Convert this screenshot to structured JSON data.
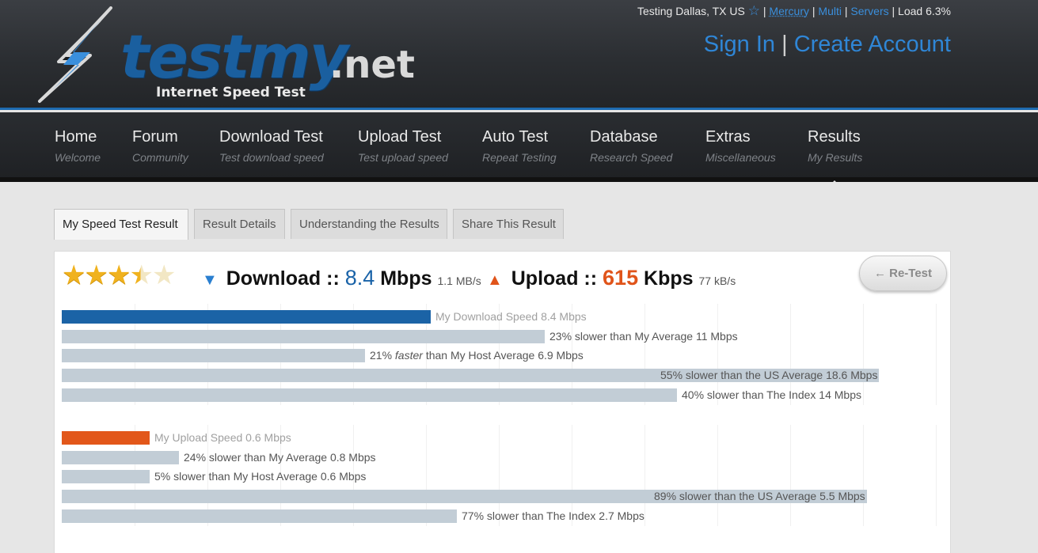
{
  "header": {
    "logo_text": "testmy",
    "logo_tld": ".net",
    "logo_tagline": "Internet Speed Test",
    "testing_location": "Testing Dallas, TX US",
    "server_links": [
      "Mercury",
      "Multi",
      "Servers"
    ],
    "load_text": "Load 6.3%",
    "sign_in": "Sign In",
    "create_account": "Create Account",
    "divider": "|"
  },
  "nav": [
    {
      "title": "Home",
      "sub": "Welcome"
    },
    {
      "title": "Forum",
      "sub": "Community"
    },
    {
      "title": "Download Test",
      "sub": "Test download speed"
    },
    {
      "title": "Upload Test",
      "sub": "Test upload speed"
    },
    {
      "title": "Auto Test",
      "sub": "Repeat Testing"
    },
    {
      "title": "Database",
      "sub": "Research Speed"
    },
    {
      "title": "Extras",
      "sub": "Miscellaneous"
    },
    {
      "title": "Results",
      "sub": "My Results"
    }
  ],
  "tabs": [
    "My Speed Test Result",
    "Result Details",
    "Understanding the Results",
    "Share This Result"
  ],
  "result": {
    "rating": 3.5,
    "download_label": "Download ::",
    "download_value": "8.4",
    "download_unit": "Mbps",
    "download_small": "1.1 MB/s",
    "upload_label": "Upload ::",
    "upload_value": "615",
    "upload_unit": "Kbps",
    "upload_small": "77 kB/s",
    "retest_label": "← Re-Test"
  },
  "chart_data": [
    {
      "type": "bar",
      "orientation": "horizontal",
      "unit": "Mbps",
      "xlim": [
        0,
        18.6
      ],
      "bars": [
        {
          "value": 8.4,
          "label": "My Download Speed 8.4 Mbps",
          "primary": true
        },
        {
          "value": 11,
          "label": "23% slower than My Average 11 Mbps"
        },
        {
          "value": 6.9,
          "label_parts": [
            "21% ",
            "faster",
            " than My Host Average 6.9 Mbps"
          ]
        },
        {
          "value": 18.6,
          "label": "55% slower than the US Average 18.6 Mbps"
        },
        {
          "value": 14,
          "label": "40% slower than The Index 14 Mbps"
        }
      ]
    },
    {
      "type": "bar",
      "orientation": "horizontal",
      "unit": "Mbps",
      "xlim": [
        0,
        5.5
      ],
      "bars": [
        {
          "value": 0.6,
          "label": "My Upload Speed 0.6 Mbps",
          "primary": true
        },
        {
          "value": 0.8,
          "label": "24% slower than My Average 0.8 Mbps"
        },
        {
          "value": 0.6,
          "label": "5% slower than My Host Average 0.6 Mbps"
        },
        {
          "value": 5.5,
          "label": "89% slower than the US Average 5.5 Mbps"
        },
        {
          "value": 2.7,
          "label": "77% slower than The Index 2.7 Mbps"
        }
      ]
    }
  ],
  "colors": {
    "download": "#1b63a6",
    "upload": "#e2571a",
    "comparison": "#c2cdd6",
    "link": "#2f86d6"
  }
}
